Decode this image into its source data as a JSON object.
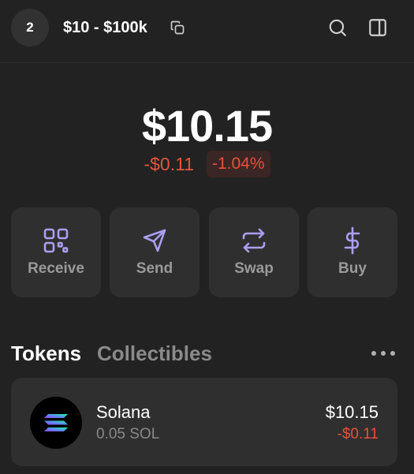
{
  "header": {
    "account_index": "2",
    "account_name": "$10 - $100k",
    "icons": {
      "copy": "copy-icon",
      "search": "search-icon",
      "panel": "side-panel-icon"
    }
  },
  "balance": {
    "total": "$10.15",
    "change_amount": "-$0.11",
    "change_percent": "-1.04%"
  },
  "actions": [
    {
      "label": "Receive",
      "icon": "qr-code-icon"
    },
    {
      "label": "Send",
      "icon": "paper-plane-icon"
    },
    {
      "label": "Swap",
      "icon": "swap-arrows-icon"
    },
    {
      "label": "Buy",
      "icon": "dollar-icon"
    }
  ],
  "tabs": [
    {
      "label": "Tokens",
      "active": true
    },
    {
      "label": "Collectibles",
      "active": false
    }
  ],
  "tokens": [
    {
      "name": "Solana",
      "amount": "0.05 SOL",
      "value": "$10.15",
      "change": "-$0.11",
      "icon": "solana-logo"
    }
  ],
  "colors": {
    "background": "#222222",
    "card": "#2f2f2f",
    "accent": "#ab9ff2",
    "negative": "#e5533c"
  }
}
